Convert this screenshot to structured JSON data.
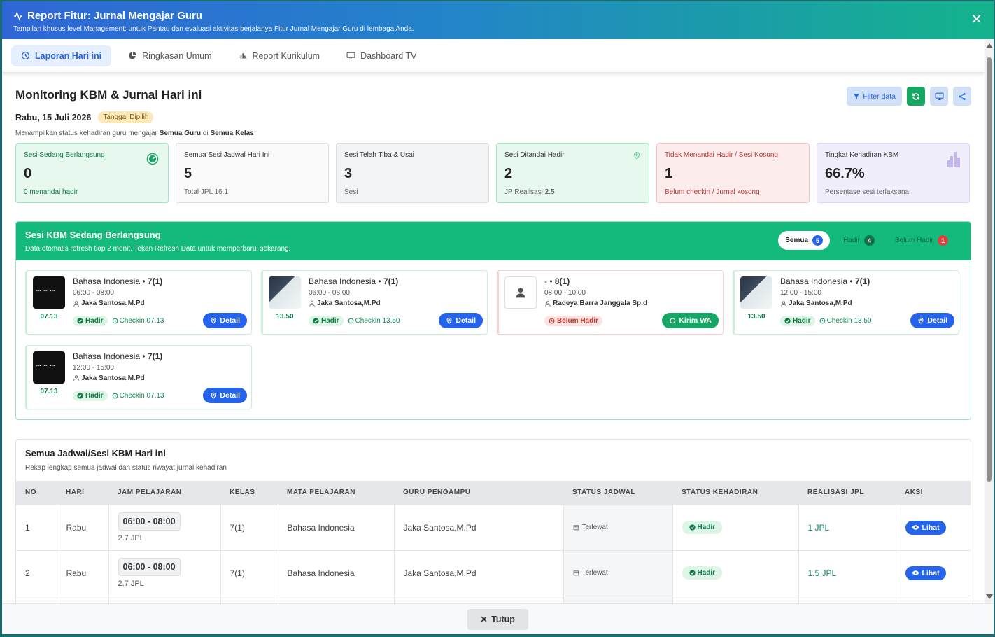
{
  "header": {
    "title": "Report Fitur: Jurnal Mengajar Guru",
    "subtitle": "Tampilan khusus level Management: untuk Pantau dan evaluasi aktivitas berjalanya Fitur Jurnal Mengajar Guru di lembaga Anda.",
    "close": "✕"
  },
  "tabs": [
    {
      "label": "Laporan Hari ini"
    },
    {
      "label": "Ringkasan Umum"
    },
    {
      "label": "Report Kurikulum"
    },
    {
      "label": "Dashboard TV"
    }
  ],
  "page": {
    "title": "Monitoring KBM & Jurnal Hari ini",
    "date": "Rabu, 15 Juli 2026",
    "date_badge": "Tanggal Dipilih",
    "desc_prefix": "Menampilkan status kehadiran guru mengajar",
    "desc_guru": "Semua Guru",
    "desc_mid": "di",
    "desc_kelas": "Semua Kelas",
    "filter_label": "Filter data"
  },
  "stats": [
    {
      "label": "Sesi Sedang Berlangsung",
      "value": "0",
      "sub": "0 menandai hadir"
    },
    {
      "label": "Semua Sesi Jadwal Hari Ini",
      "value": "5",
      "sub": "Total JPL 16.1"
    },
    {
      "label": "Sesi Telah Tiba & Usai",
      "value": "3",
      "sub": "Sesi"
    },
    {
      "label": "Sesi Ditandai Hadir",
      "value": "2",
      "sub_prefix": "JP Realisasi",
      "sub_bold": "2.5"
    },
    {
      "label": "Tidak Menandai Hadir / Sesi Kosong",
      "value": "1",
      "sub": "Belum checkin / Jurnal kosong"
    },
    {
      "label": "Tingkat Kehadiran KBM",
      "value": "66.7%",
      "sub": "Persentase sesi terlaksana"
    }
  ],
  "live": {
    "title": "Sesi KBM Sedang Berlangsung",
    "subtitle": "Data otomatis refresh tiap 2 menit. Tekan Refresh Data untuk memperbarui sekarang.",
    "filters": [
      {
        "label": "Semua",
        "count": "5"
      },
      {
        "label": "Hadir",
        "count": "4"
      },
      {
        "label": "Belum Hadir",
        "count": "1"
      }
    ],
    "cards": [
      {
        "subject": "Bahasa Indonesia",
        "sep": " • ",
        "kelas": "7(1)",
        "time": "06:00 - 08:00",
        "teacher": "Jaka Santosa,M.Pd",
        "thumb_time": "07.13",
        "status": "Hadir",
        "checkin": "Checkin 07.13",
        "button": "Detail"
      },
      {
        "subject": "Bahasa Indonesia",
        "sep": " • ",
        "kelas": "7(1)",
        "time": "06:00 - 08:00",
        "teacher": "Jaka Santosa,M.Pd",
        "thumb_time": "13.50",
        "status": "Hadir",
        "checkin": "Checkin 13.50",
        "button": "Detail"
      },
      {
        "subject": "-",
        "sep": " • ",
        "kelas": "8(1)",
        "time": "08:00 - 10:00",
        "teacher": "Radeya Barra Janggala Sp.d",
        "thumb_time": "",
        "status": "Belum Hadir",
        "checkin": "",
        "button": "Kirim WA"
      },
      {
        "subject": "Bahasa Indonesia",
        "sep": " • ",
        "kelas": "7(1)",
        "time": "12:00 - 15:00",
        "teacher": "Jaka Santosa,M.Pd",
        "thumb_time": "13.50",
        "status": "Hadir",
        "checkin": "Checkin 13.50",
        "button": "Detail"
      },
      {
        "subject": "Bahasa Indonesia",
        "sep": " • ",
        "kelas": "7(1)",
        "time": "12:00 - 15:00",
        "teacher": "Jaka Santosa,M.Pd",
        "thumb_time": "07.13",
        "status": "Hadir",
        "checkin": "Checkin 07.13",
        "button": "Detail"
      }
    ]
  },
  "schedule": {
    "title": "Semua Jadwal/Sesi KBM Hari ini",
    "subtitle": "Rekap lengkap semua jadwal dan status riwayat jurnal kehadiran",
    "columns": [
      "NO",
      "HARI",
      "JAM PELAJARAN",
      "KELAS",
      "MATA PELAJARAN",
      "GURU PENGAMPU",
      "STATUS JADWAL",
      "STATUS KEHADIRAN",
      "REALISASI JPL",
      "AKSI"
    ],
    "rows": [
      {
        "no": "1",
        "hari": "Rabu",
        "jam": "06:00 - 08:00",
        "jpl": "2.7 JPL",
        "kelas": "7(1)",
        "mapel": "Bahasa Indonesia",
        "guru": "Jaka Santosa,M.Pd",
        "status_jadwal": "Terlewat",
        "status_hadir": "Hadir",
        "realisasi": "1 JPL",
        "aksi": "Lihat"
      },
      {
        "no": "2",
        "hari": "Rabu",
        "jam": "06:00 - 08:00",
        "jpl": "2.7 JPL",
        "kelas": "7(1)",
        "mapel": "Bahasa Indonesia",
        "guru": "Jaka Santosa,M.Pd",
        "status_jadwal": "Terlewat",
        "status_hadir": "Hadir",
        "realisasi": "1.5 JPL",
        "aksi": "Lihat"
      }
    ]
  },
  "footer": {
    "close_label": "Tutup"
  },
  "colors": {
    "primary": "#2563eb",
    "success": "#14b97c",
    "danger": "#c0392b"
  }
}
